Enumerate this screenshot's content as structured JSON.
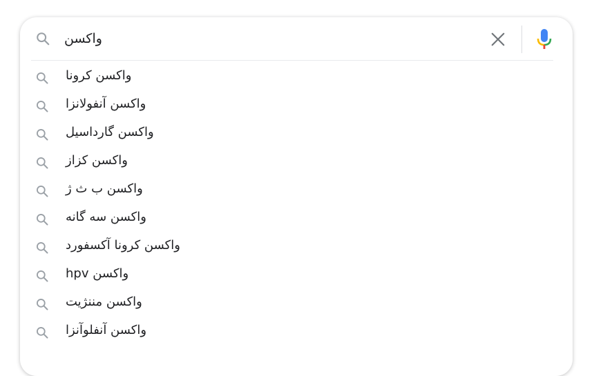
{
  "search": {
    "query": "واکسن",
    "clear_icon": "close-icon",
    "mic_icon": "microphone-icon",
    "search_icon": "search-icon"
  },
  "colors": {
    "mic_blue": "#4285F4",
    "mic_red": "#EA4335",
    "mic_yellow": "#FBBC05",
    "mic_green": "#34A853",
    "icon_gray": "#9aa0a6",
    "text": "#202124"
  },
  "suggestions": [
    {
      "label": "واکسن کرونا"
    },
    {
      "label": "واکسن آنفولانزا"
    },
    {
      "label": "واکسن گارداسیل"
    },
    {
      "label": "واکسن کزاز"
    },
    {
      "label": "واکسن ب ث ژ"
    },
    {
      "label": "واکسن سه گانه"
    },
    {
      "label": "واکسن کرونا آکسفورد"
    },
    {
      "label": "واکسن hpv"
    },
    {
      "label": "واکسن مننژیت"
    },
    {
      "label": "واکسن آنفلوآنزا"
    }
  ]
}
